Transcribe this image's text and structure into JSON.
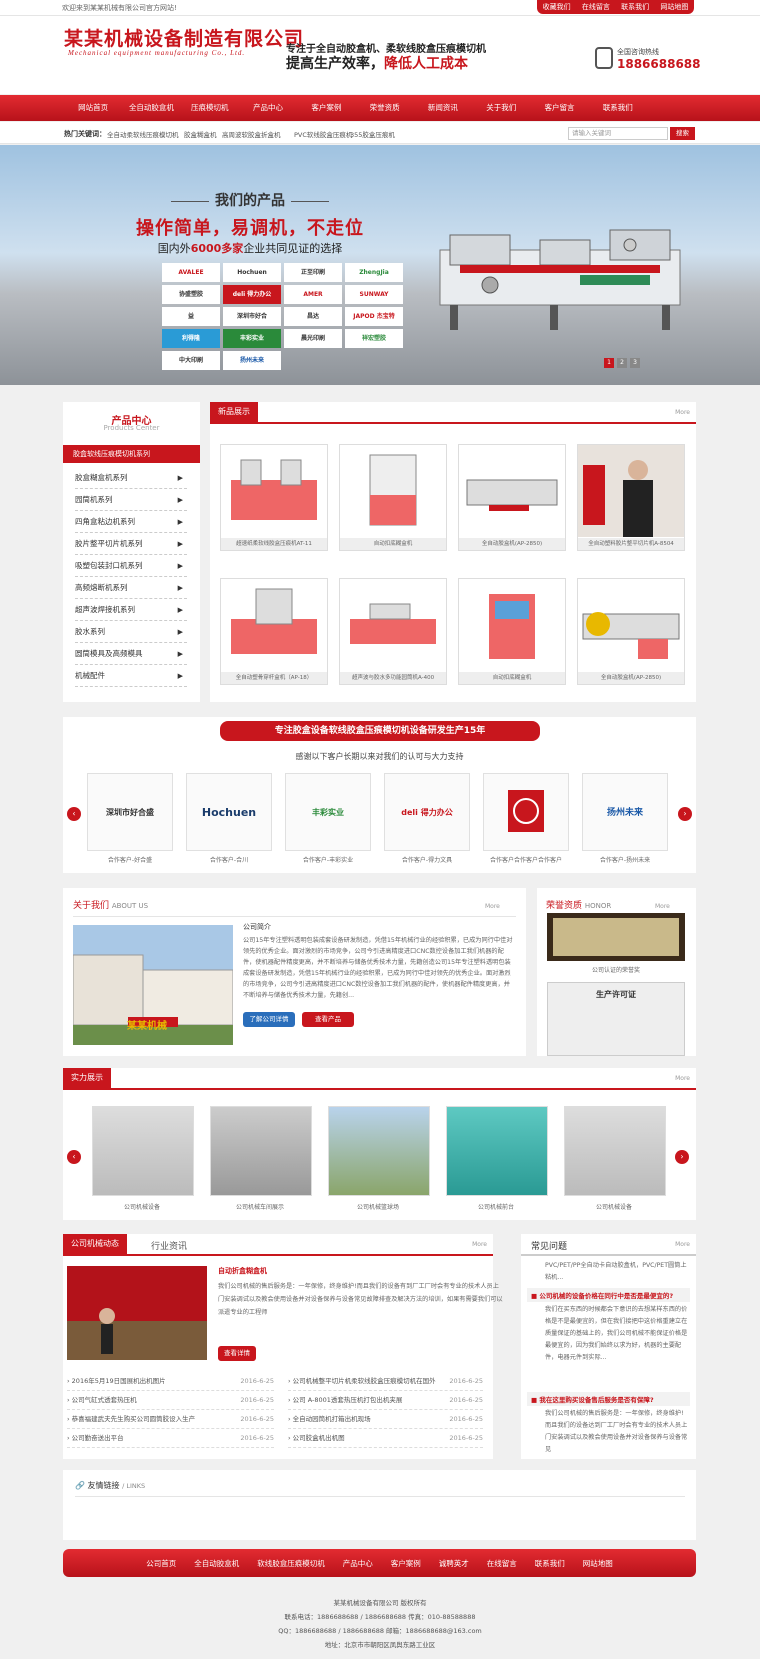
{
  "topbar": {
    "welcome": "欢迎来到某某机械有限公司官方网站!",
    "links": [
      "收藏我们",
      "在线留言",
      "联系我们",
      "网站地图"
    ]
  },
  "header": {
    "company": "某某机械设备制造有限公司",
    "company_en": "Mechanical equipment manufacturing Co., Ltd.",
    "slogan1": "专注于全自动胶盒机、柔软线胶盒压痕模切机",
    "slogan2a": "提高生产效率，",
    "slogan2b": "降低人工成本",
    "hotline_label": "全国咨询热线",
    "hotline": "1886688688"
  },
  "nav": [
    "网站首页",
    "全自动胶盒机",
    "压痕模切机",
    "产品中心",
    "客户案例",
    "荣誉资质",
    "新闻资讯",
    "关于我们",
    "客户留言",
    "联系我们"
  ],
  "hotkw": {
    "label": "热门关键词：",
    "items": [
      "全自动柔软线压痕模切机",
      "胶盒糊盒机",
      "高周波软胶盒折盒机",
      "PVC软线胶盒压痕机",
      "355胶盒压痕机"
    ]
  },
  "search": {
    "placeholder": "请输入关键词",
    "button": "搜索"
  },
  "banner": {
    "title": "我们的产品",
    "headline": "操作简单，易调机，不走位",
    "sub_a": "国内外",
    "sub_b": "6000多家",
    "sub_c": "企业共同见证的选择",
    "brands": [
      "AVALEE",
      "Hochuen",
      "正至印刷",
      "ZhengJia",
      "协盛塑胶",
      "deli 得力办公",
      "AMER",
      "SUNWAY",
      "益",
      "深圳市好合",
      "昌达",
      "JAPOD 杰宝特",
      "利得隆",
      "丰彩实业",
      "晨光印刷",
      "祥宏塑胶",
      "中大印刷",
      "扬州未来"
    ],
    "slides": [
      "1",
      "2",
      "3"
    ]
  },
  "sidebar": {
    "title": "产品中心",
    "title_en": "Products Center",
    "active": "胶盒软线压痕模切机系列",
    "items": [
      "胶盒糊盒机系列",
      "园筒机系列",
      "四角盒粘边机系列",
      "胶片整平切片机系列",
      "吸塑包装封口机系列",
      "高频熔断机系列",
      "超声波焊接机系列",
      "胶水系列",
      "圆筒模具及高频模具",
      "机械配件"
    ]
  },
  "newproducts": {
    "title": "新品展示",
    "more": "More",
    "items": [
      "超速纸柔软线胶盒压痕机AT-11",
      "自动扣底糊盒机",
      "全自动胶盒机(AP-2850)",
      "全自动塑料胶片整平切片机A-8504",
      "全自动塑骨穿杆盒机（AP-18）",
      "超声波与胶水多功能园筒机A-400",
      "自动扣底糊盒机",
      "全自动胶盒机(AP-2850)"
    ]
  },
  "clients": {
    "title": "专注胶盒设备软线胶盒压痕模切机设备研发生产15年",
    "subtitle": "感谢以下客户长期以来对我们的认可与大力支持",
    "logos": [
      "深圳市好合盛",
      "Hochuen",
      "丰彩实业",
      "deli 得力办公",
      "扬州未来"
    ],
    "captions": [
      "合作客户-好合盛",
      "合作客户-合川",
      "合作客户-丰彩实业",
      "合作客户-得力文具",
      "合作客户合作客户合作客户",
      "合作客户-扬州未来"
    ]
  },
  "about": {
    "title": "关于我们",
    "title_en": "ABOUT US",
    "more": "More",
    "subtitle": "公司简介",
    "text": "公司15年专注塑料透明包装成套设备研发制造，凭借15年机械行业的经验积累，已成为同行中佳对领先的优秀企业。面对激烈的市场竞争，公司今引进高精度进口CNC数控设备加工我们机器的配件，使机器配件精度更高，并不断培养与储备优秀技术力量，先籍创造公司15年专注塑料透明包装成套设备研发制造，凭借15年机械行业的经验积累，已成为同行中佳对领先的优秀企业。面对激烈的市场竞争，公司今引进高精度进口CNC数控设备加工我们机器的配件，使机器配件精度更高，并不断培养与储备优秀技术力量，先籍创...",
    "btn1": "了解公司详情",
    "btn2": "查看产品",
    "sign": "某某机械"
  },
  "honor": {
    "title": "荣誉资质",
    "title_en": "HONOR",
    "more": "More",
    "cap1": "公司认证的荣誉奖",
    "cert": "生产许可证"
  },
  "strength": {
    "title": "实力展示",
    "more": "More",
    "captions": [
      "公司机械设备",
      "公司机械车间展示",
      "公司机械篮球场",
      "公司机械前台",
      "公司机械设备"
    ]
  },
  "news": {
    "tabs": [
      "公司机械动态",
      "行业资讯"
    ],
    "more": "More",
    "feature_title": "自动折盒糊盒机",
    "feature_text": "我们公司机械的售后服务是：一年保修，终身维护!而且我们的设备有到厂工厂时会有专业的技术人员上门安装调试以及教会使用设备并对设备保养与设备常见故障排查及解决方法的培训，如果有需要我们可以派遣专业的工程师",
    "feature_btn": "查看详情",
    "left": [
      {
        "t": "2016年5月19日国展机出机图片",
        "d": "2016-6-25"
      },
      {
        "t": "公司气缸式透套热压机",
        "d": "2016-6-25"
      },
      {
        "t": "恭喜福建武夫先生购买公司圆筒胶设入生产",
        "d": "2016-6-25"
      },
      {
        "t": "公司勤奋送出平台",
        "d": "2016-6-25"
      }
    ],
    "right": [
      {
        "t": "公司机械整平切片机柔软线胶盒压痕模切机在国外",
        "d": "2016-6-25"
      },
      {
        "t": "公司 A-8001透套热压机打包出机夹展",
        "d": "2016-6-25"
      },
      {
        "t": "全自动园筒机打箱出机现场",
        "d": "2016-6-25"
      },
      {
        "t": "公司胶盒机出机图",
        "d": "2016-6-25"
      }
    ]
  },
  "faq": {
    "title": "常见问题",
    "more": "More",
    "top_text": "PVC/PET/PP全自动卡自动胶盒机，PVC/PET圆筒上粘机...",
    "q1": "公司机械的设备价格在同行中是否是最便宜的?",
    "a1": "我们在买东西的时候都会下意识的去想某样东西的价格是不是最便宜的，但在我们接把中这价格重建立在质量保证的基础上的，我们公司机械不能保证价格是最便宜的，因为我们始终以求为好，机器的主要配件，电器元件到实际...",
    "q2": "我在这里购买设备售后服务是否有保障?",
    "a2": "我们公司机械的售后服务是：一年保修，终身维护!而且我们的设备达到厂工厂时会有专业的技术人员上门安装调试以及教会使用设备并对设备保养与设备常见"
  },
  "links": {
    "title": "友情链接",
    "title_en": "/ LINKS"
  },
  "footnav": [
    "公司首页",
    "全自动胶盒机",
    "软线胶盒压痕模切机",
    "产品中心",
    "客户案例",
    "诚聘英才",
    "在线留言",
    "联系我们",
    "网站地图"
  ],
  "footer": {
    "l1": "某某机械设备有限公司 版权所有",
    "l2": "联系电话：1886688688 / 1886688688 传真：010-88588888",
    "l3": "QQ：1886688688 / 1886688688 邮箱：1886688688@163.com",
    "l4": "地址：北京市市朝阳区凤舆东路工业区"
  },
  "colors": {
    "brand_red": "#c8161d"
  }
}
